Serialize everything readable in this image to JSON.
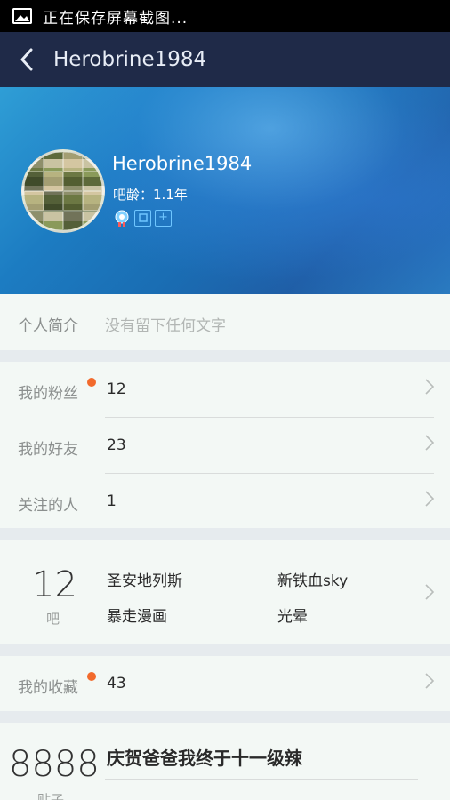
{
  "statusbar": {
    "text": "正在保存屏幕截图..."
  },
  "navbar": {
    "title": "Herobrine1984"
  },
  "profile": {
    "name": "Herobrine1984",
    "bar_age": "吧龄：1.1年",
    "badge_plus": "+"
  },
  "intro": {
    "label": "个人简介",
    "value": "没有留下任何文字"
  },
  "social": {
    "fans": {
      "label": "我的粉丝",
      "value": "12"
    },
    "friends": {
      "label": "我的好友",
      "value": "23"
    },
    "following": {
      "label": "关注的人",
      "value": "1"
    }
  },
  "bars": {
    "count": "12",
    "unit": "吧",
    "items": [
      "圣安地列斯",
      "新铁血sky",
      "暴走漫画",
      "光晕"
    ]
  },
  "favorites": {
    "label": "我的收藏",
    "value": "43"
  },
  "posts": {
    "count": "8888",
    "unit": "贴子",
    "latest": "庆贺爸爸我终于十一级辣"
  },
  "colors": {
    "accent_dot": "#f26a2c",
    "navbar": "#1f2a48"
  }
}
